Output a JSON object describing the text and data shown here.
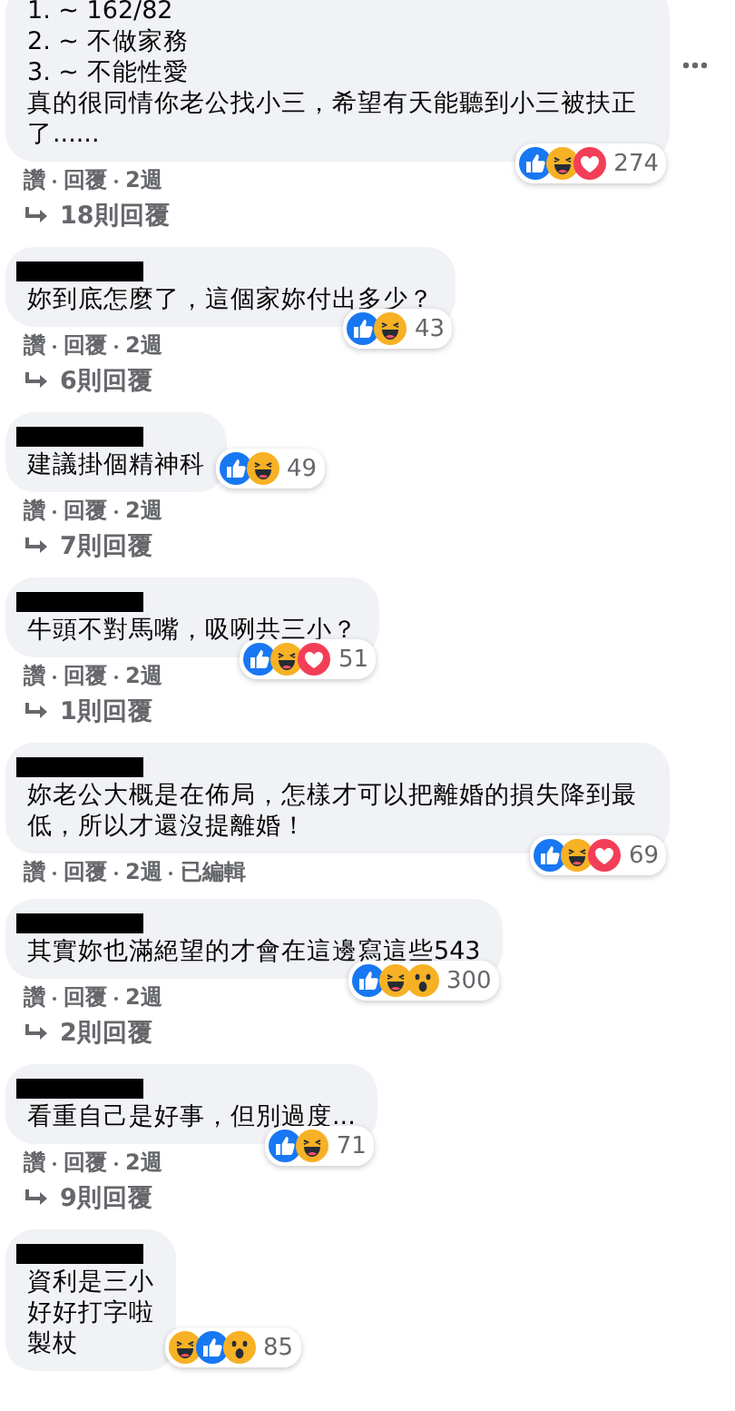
{
  "comments": [
    {
      "name_redacted": false,
      "lines": [
        "1. ~ 162/82",
        "2. ~ 不做家務",
        "3. ~ 不能性愛",
        "真的很同情你老公找小三，希望有天能聽到小三被扶正了......"
      ],
      "reactions": [
        {
          "kind": "like"
        },
        {
          "kind": "haha"
        },
        {
          "kind": "love"
        }
      ],
      "reaction_count": "274",
      "reactions_beside": false,
      "actions": [
        "讚",
        "回覆",
        "2週"
      ],
      "replies": "18則回覆"
    },
    {
      "name_redacted": true,
      "lines": [
        "妳到底怎麼了，這個家妳付出多少？"
      ],
      "reactions": [
        {
          "kind": "like"
        },
        {
          "kind": "haha"
        }
      ],
      "reaction_count": "43",
      "reactions_beside": false,
      "actions": [
        "讚",
        "回覆",
        "2週"
      ],
      "replies": "6則回覆"
    },
    {
      "name_redacted": true,
      "lines": [
        "建議掛個精神科"
      ],
      "reactions": [
        {
          "kind": "like"
        },
        {
          "kind": "haha"
        }
      ],
      "reaction_count": "49",
      "reactions_beside": true,
      "actions": [
        "讚",
        "回覆",
        "2週"
      ],
      "replies": "7則回覆"
    },
    {
      "name_redacted": true,
      "lines": [
        "牛頭不對馬嘴，吸咧共三小？"
      ],
      "reactions": [
        {
          "kind": "like"
        },
        {
          "kind": "haha"
        },
        {
          "kind": "love"
        }
      ],
      "reaction_count": "51",
      "reactions_beside": false,
      "actions": [
        "讚",
        "回覆",
        "2週"
      ],
      "replies": "1則回覆"
    },
    {
      "name_redacted": true,
      "lines": [
        "妳老公大概是在佈局，怎樣才可以把離婚的損失降到最低，所以才還沒提離婚！"
      ],
      "reactions": [
        {
          "kind": "like"
        },
        {
          "kind": "haha"
        },
        {
          "kind": "love"
        }
      ],
      "reaction_count": "69",
      "reactions_beside": false,
      "actions": [
        "讚",
        "回覆",
        "2週",
        "已編輯"
      ]
    },
    {
      "name_redacted": true,
      "lines": [
        "其實妳也滿絕望的才會在這邊寫這些543"
      ],
      "reactions": [
        {
          "kind": "like"
        },
        {
          "kind": "haha"
        },
        {
          "kind": "wow"
        }
      ],
      "reaction_count": "300",
      "reactions_beside": false,
      "actions": [
        "讚",
        "回覆",
        "2週"
      ],
      "replies": "2則回覆"
    },
    {
      "name_redacted": true,
      "lines": [
        "看重自己是好事，但別過度..."
      ],
      "reactions": [
        {
          "kind": "like"
        },
        {
          "kind": "haha"
        }
      ],
      "reaction_count": "71",
      "reactions_beside": false,
      "actions": [
        "讚",
        "回覆",
        "2週"
      ],
      "replies": "9則回覆"
    },
    {
      "name_redacted": true,
      "lines": [
        "資利是三小",
        "好好打字啦",
        "製杖"
      ],
      "reactions": [
        {
          "kind": "haha"
        },
        {
          "kind": "like"
        },
        {
          "kind": "wow"
        }
      ],
      "reaction_count": "85",
      "reactions_beside": true
    }
  ]
}
